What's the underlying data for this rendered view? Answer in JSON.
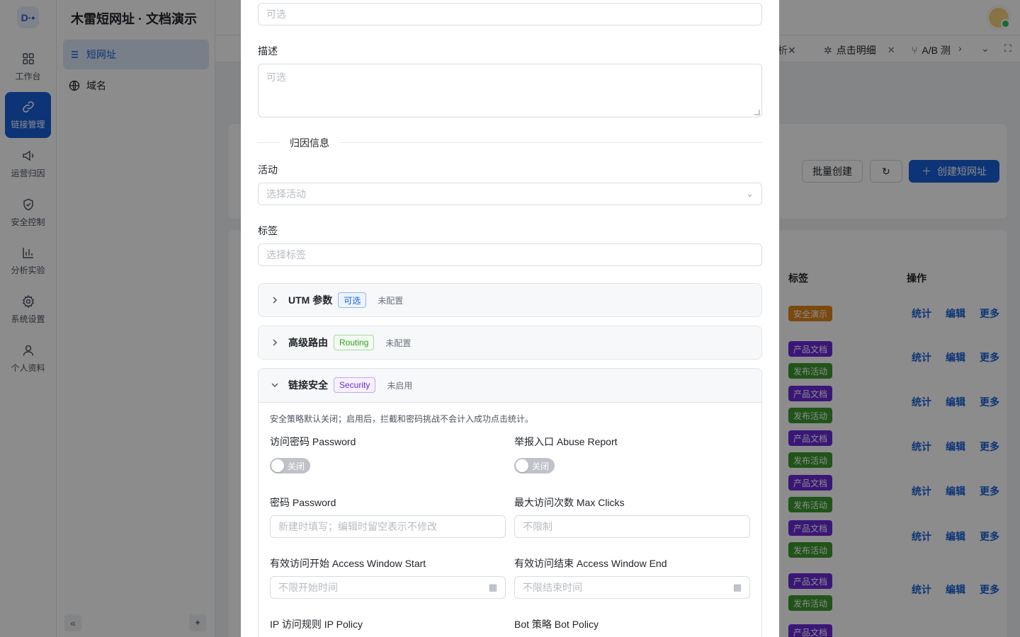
{
  "app": {
    "title": "木雷短网址 · 文档演示",
    "logo": "D·•"
  },
  "rail": [
    {
      "label": "工作台",
      "icon": "dashboard-icon"
    },
    {
      "label": "链接管理",
      "icon": "link-icon",
      "active": true
    },
    {
      "label": "运营归因",
      "icon": "megaphone-icon"
    },
    {
      "label": "安全控制",
      "icon": "shield-icon"
    },
    {
      "label": "分析实验",
      "icon": "bar-chart-icon"
    },
    {
      "label": "系统设置",
      "icon": "gear-icon"
    },
    {
      "label": "个人资料",
      "icon": "user-icon"
    }
  ],
  "subnav": [
    {
      "label": "短网址",
      "icon": "list-icon",
      "active": true
    },
    {
      "label": "域名",
      "icon": "globe-icon"
    }
  ],
  "tabs": [
    {
      "label": "析",
      "closable": true
    },
    {
      "label": "点击明细",
      "closable": true
    },
    {
      "label": "A/B 测",
      "closable": false
    }
  ],
  "toolbar": {
    "batch_create": "批量创建",
    "create": "创建短网址"
  },
  "table": {
    "headers": {
      "tags": "标签",
      "actions": "操作"
    },
    "rows": [
      {
        "tags": [
          {
            "text": "安全演示",
            "color": "orange"
          }
        ]
      },
      {
        "tags": [
          {
            "text": "产品文档",
            "color": "purple"
          },
          {
            "text": "发布活动",
            "color": "green"
          }
        ]
      },
      {
        "tags": [
          {
            "text": "产品文档",
            "color": "purple"
          },
          {
            "text": "发布活动",
            "color": "green"
          }
        ]
      },
      {
        "tags": [
          {
            "text": "产品文档",
            "color": "purple"
          },
          {
            "text": "发布活动",
            "color": "green"
          }
        ]
      },
      {
        "tags": [
          {
            "text": "产品文档",
            "color": "purple"
          },
          {
            "text": "发布活动",
            "color": "green"
          }
        ]
      },
      {
        "tags": [
          {
            "text": "产品文档",
            "color": "purple"
          },
          {
            "text": "发布活动",
            "color": "green"
          }
        ]
      },
      {
        "tags": [
          {
            "text": "产品文档",
            "color": "purple"
          },
          {
            "text": "发布活动",
            "color": "green"
          }
        ]
      },
      {
        "tags": [
          {
            "text": "产品文档",
            "color": "purple"
          }
        ]
      }
    ],
    "actions": {
      "stats": "统计",
      "edit": "编辑",
      "more": "更多"
    }
  },
  "modal": {
    "top_input_placeholder": "可选",
    "description": {
      "label": "描述",
      "placeholder": "可选"
    },
    "attribution_divider": "归因信息",
    "campaign": {
      "label": "活动",
      "placeholder": "选择活动"
    },
    "tags": {
      "label": "标签",
      "placeholder": "选择标签"
    },
    "utm": {
      "title": "UTM 参数",
      "badge": "可选",
      "status": "未配置"
    },
    "routing": {
      "title": "高级路由",
      "badge": "Routing",
      "status": "未配置"
    },
    "security": {
      "title": "链接安全",
      "badge": "Security",
      "status": "未启用",
      "hint": "安全策略默认关闭；启用后，拦截和密码挑战不会计入成功点击统计。",
      "password_toggle": {
        "label": "访问密码 Password",
        "state": "关闭"
      },
      "abuse_toggle": {
        "label": "举报入口 Abuse Report",
        "state": "关闭"
      },
      "password": {
        "label": "密码 Password",
        "placeholder": "新建时填写；编辑时留空表示不修改"
      },
      "max_clicks": {
        "label": "最大访问次数 Max Clicks",
        "placeholder": "不限制"
      },
      "window_start": {
        "label": "有效访问开始 Access Window Start",
        "placeholder": "不限开始时间"
      },
      "window_end": {
        "label": "有效访问结束 Access Window End",
        "placeholder": "不限结束时间"
      },
      "ip_policy": {
        "label": "IP 访问规则 IP Policy"
      },
      "bot_policy": {
        "label": "Bot 策略 Bot Policy"
      }
    }
  },
  "colors": {
    "primary": "#1660d9",
    "overlay": "rgba(0,0,0,0.45)"
  }
}
